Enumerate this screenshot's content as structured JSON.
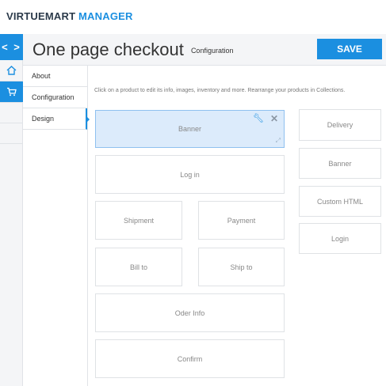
{
  "brand": {
    "part1": "VIRTUEMART",
    "part2": "MANAGER"
  },
  "rail": {
    "toggle_icon": "chevron-left-right-icon",
    "items": [
      {
        "icon": "home-icon"
      },
      {
        "icon": "cart-icon"
      }
    ]
  },
  "header": {
    "title": "One page checkout",
    "subtitle": "Configuration",
    "save_label": "SAVE"
  },
  "tabs": [
    "About",
    "Configuration",
    "Design"
  ],
  "active_tab": "Design",
  "hint": "Click on a product to edit its info, images, inventory and more. Rearrange your products in Collections.",
  "layout_blocks": {
    "banner": "Banner",
    "login": "Log in",
    "shipment": "Shipment",
    "payment": "Payment",
    "bill_to": "Bill to",
    "ship_to": "Ship to",
    "order_info": "Oder Info",
    "confirm": "Confirm"
  },
  "available_blocks": [
    "Delivery",
    "Banner",
    "Custom HTML",
    "Login"
  ],
  "colors": {
    "accent": "#1b8fe0",
    "selected_bg": "#dcebfb",
    "panel": "#f4f5f7"
  }
}
